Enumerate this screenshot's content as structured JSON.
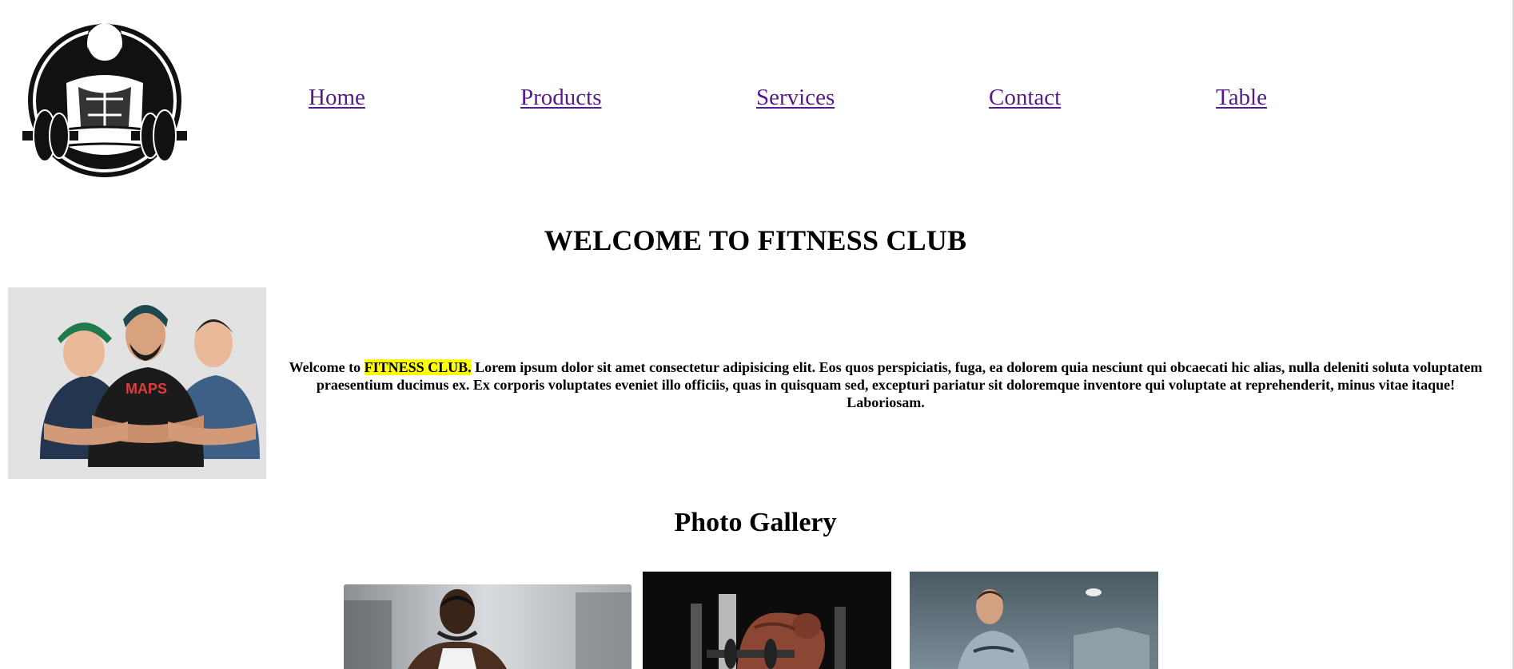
{
  "header": {
    "logo_icon": "bearded-bodybuilder-logo-icon"
  },
  "nav": {
    "items": [
      {
        "label": "Home"
      },
      {
        "label": "Products"
      },
      {
        "label": "Services"
      },
      {
        "label": "Contact"
      },
      {
        "label": "Table"
      }
    ],
    "link_color": "#551a8b"
  },
  "welcome": {
    "title": "WELCOME TO FITNESS CLUB",
    "intro_prefix": "Welcome to ",
    "intro_highlight": "FITNESS CLUB.",
    "intro_text": " Lorem ipsum dolor sit amet consectetur adipisicing elit. Eos quos perspiciatis, fuga, ea dolorem quia nesciunt qui obcaecati hic alias, nulla deleniti soluta voluptatem praesentium ducimus ex. Ex corporis voluptates eveniet illo officiis, quas in quisquam sed, excepturi pariatur sit doloremque inventore qui voluptate at reprehenderit, minus vitae itaque! Laboriosam.",
    "highlight_color": "#ffff00",
    "team_image": {
      "icon": "trainers-group-illustration",
      "shirt_text": "MAPS"
    }
  },
  "gallery": {
    "title": "Photo Gallery",
    "photos": [
      {
        "icon": "athlete-gym-photo"
      },
      {
        "icon": "bodybuilder-dumbbell-photo"
      },
      {
        "icon": "runner-treadmill-photo"
      }
    ]
  }
}
